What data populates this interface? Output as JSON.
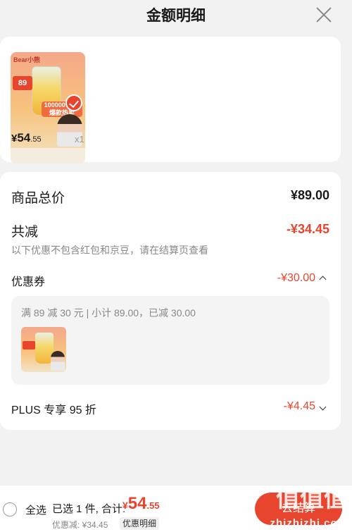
{
  "header": {
    "title": "金额明细"
  },
  "product": {
    "image_brand": "Bear小熊",
    "image_promo": "89",
    "image_badge": "100000 全网爆款热卖",
    "price_symbol": "¥",
    "price_int": "54",
    "price_dec": ".55",
    "quantity": "x1"
  },
  "summary": {
    "total_label": "商品总价",
    "total_value": "¥89.00",
    "reduce_label": "共减",
    "reduce_value": "-¥34.45",
    "note": "以下优惠不包含红包和京豆，请在结算页查看",
    "coupon_label": "优惠券",
    "coupon_value": "-¥30.00",
    "coupon_desc": "满 89 减 30 元 | 小计 89.00，已减 30.00",
    "plus_label": "PLUS 专享 95 折",
    "plus_value": "-¥4.45"
  },
  "bottom": {
    "select_all": "全选",
    "selected_text": "已选 1 件, 合计:",
    "total_symbol": "¥",
    "total_int": "54",
    "total_dec": ".55",
    "discount_text": "优惠减: ¥34.45",
    "detail_label": "优惠明细",
    "checkout_label": "去结算"
  },
  "watermark": {
    "logo": "值值值",
    "text": "zhizhizhi.com"
  },
  "colors": {
    "accent": "#e8452f",
    "background": "#f2f2f2"
  }
}
